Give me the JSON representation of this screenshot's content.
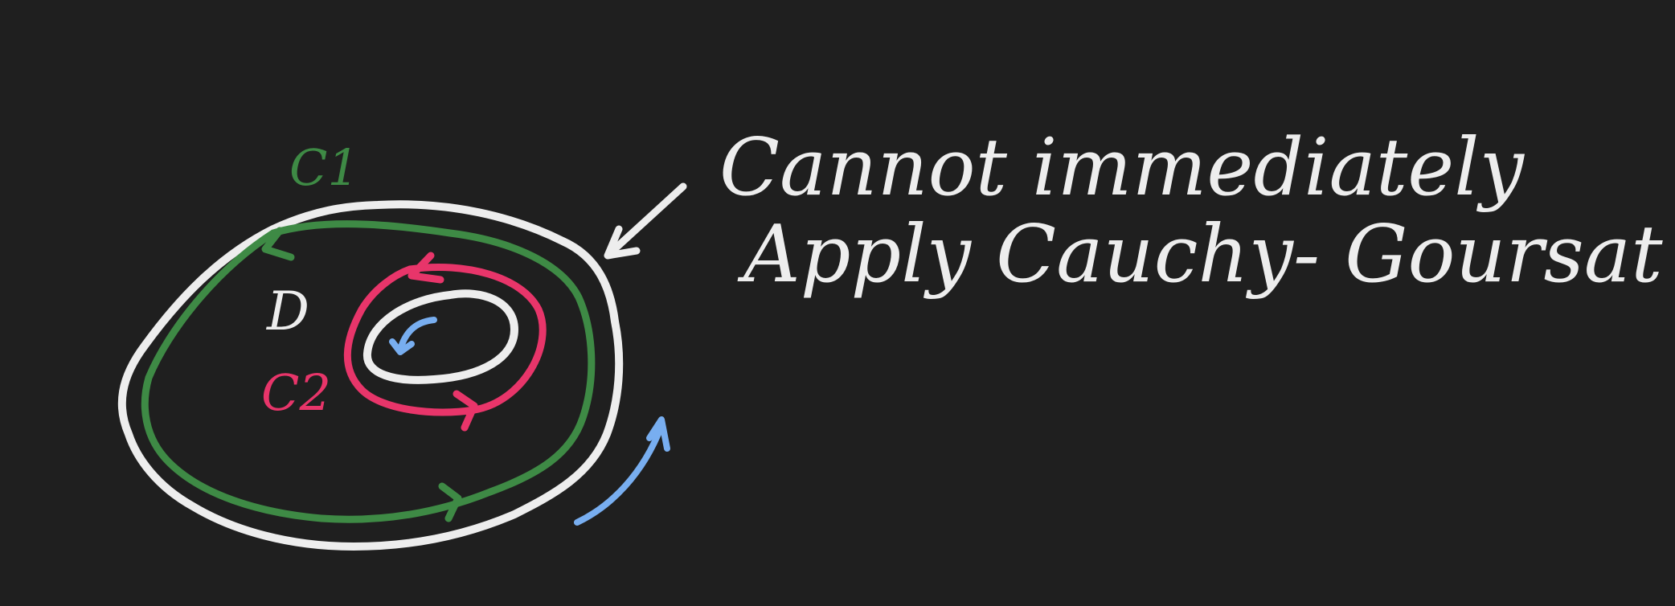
{
  "note": {
    "line1": "Cannot immediately",
    "line2": "Apply Cauchy- Goursat"
  },
  "labels": {
    "outer_contour": "C1",
    "inner_contour": "C2",
    "domain": "D"
  },
  "colors": {
    "background": "#1f1f1f",
    "chalk_white": "#ededed",
    "c1_green": "#3e8a45",
    "c2_red": "#e8356a",
    "orientation_blue": "#78aef0"
  }
}
